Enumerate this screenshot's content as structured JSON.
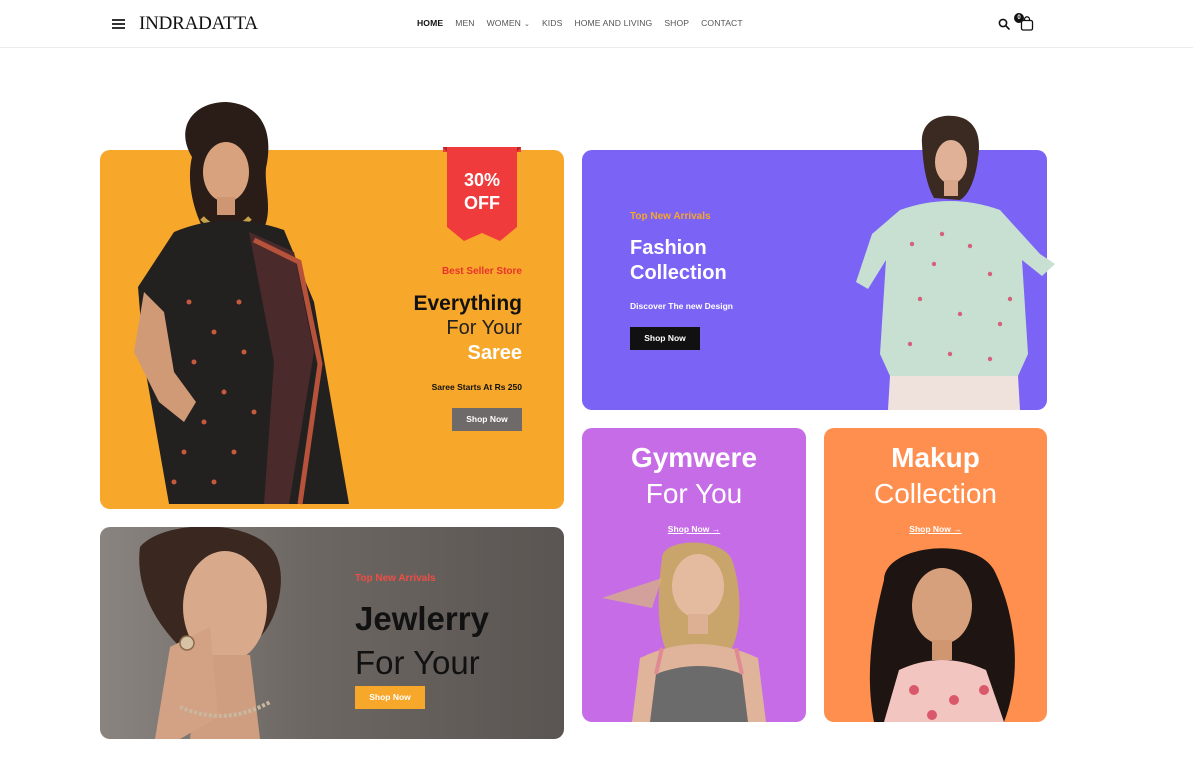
{
  "header": {
    "logo": "INDRADATTA",
    "nav": [
      "HOME",
      "MEN",
      "WOMEN",
      "KIDS",
      "HOME AND LIVING",
      "SHOP",
      "CONTACT"
    ],
    "cart_count": "0"
  },
  "saree_banner": {
    "discount_line1": "30%",
    "discount_line2": "OFF",
    "tag": "Best Seller Store",
    "title_line1": "Everything",
    "title_line2": "For Your",
    "title_line3": "Saree",
    "subtitle": "Saree Starts At Rs 250",
    "button": "Shop Now"
  },
  "fashion_banner": {
    "tag": "Top New Arrivals",
    "title_line1": "Fashion",
    "title_line2": "Collection",
    "subtitle": "Discover The new Design",
    "button": "Shop Now"
  },
  "jewelry_banner": {
    "tag": "Top New Arrivals",
    "title_line1": "Jewlerry",
    "title_line2": "For Your",
    "button": "Shop Now"
  },
  "gym_banner": {
    "title_line1": "Gymwere",
    "title_line2": "For You",
    "link": "Shop Now"
  },
  "makeup_banner": {
    "title_line1": "Makup",
    "title_line2": "Collection",
    "link": "Shop Now"
  },
  "colors": {
    "saree_bg": "#f7a72a",
    "fashion_bg": "#7b63f5",
    "gym_bg": "#c66ce6",
    "makeup_bg": "#ff8f4e",
    "accent_red": "#e8332d"
  }
}
